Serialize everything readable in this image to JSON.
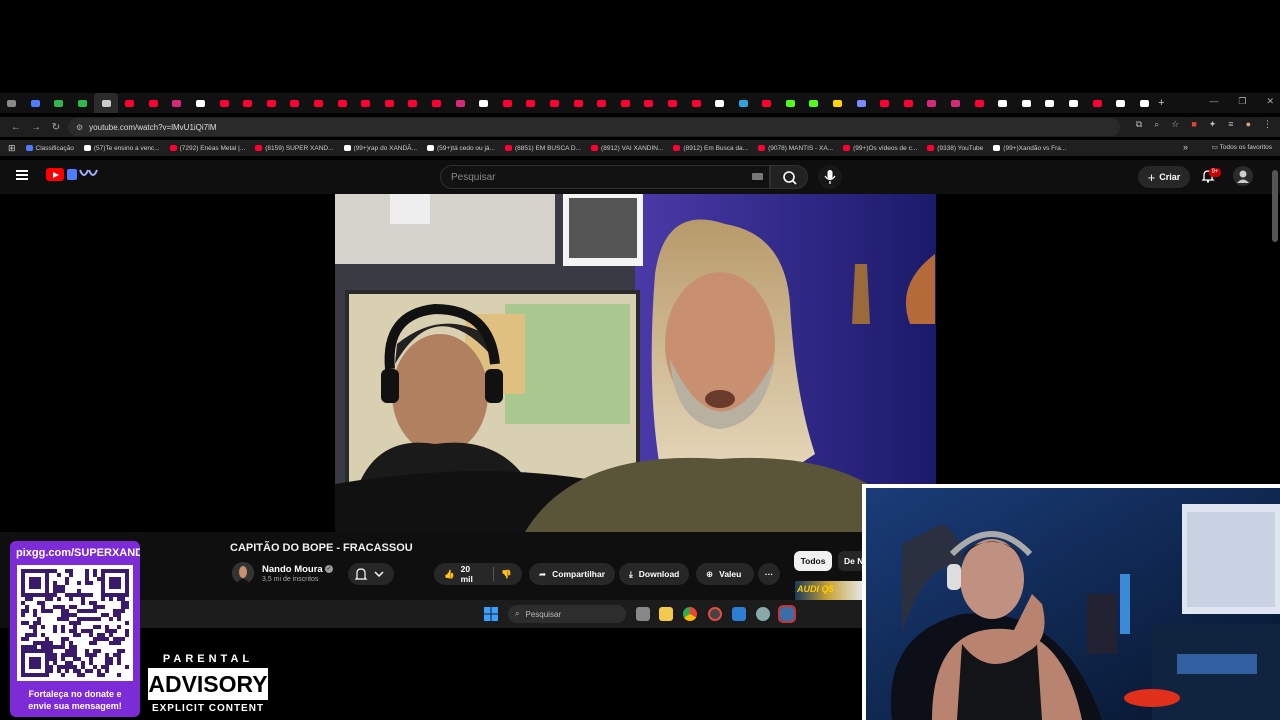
{
  "browser": {
    "url": "youtube.com/watch?v=lMvU1iQi7lM",
    "tab_colors": [
      "#888888",
      "#4f7cff",
      "#2fb84d",
      "#2fb84d",
      "#cccccc",
      "#ff0033",
      "#ff0033",
      "#d62976",
      "#ffffff",
      "#ff0033",
      "#ff0033",
      "#ff0033",
      "#ff0033",
      "#ff0033",
      "#ff0033",
      "#ff0033",
      "#ff0033",
      "#ff0033",
      "#ff0033",
      "#d62976",
      "#ffffff",
      "#ff0033",
      "#ff0033",
      "#ff0033",
      "#ff0033",
      "#ff0033",
      "#ff0033",
      "#ff0033",
      "#ff0033",
      "#ff0033",
      "#ffffff",
      "#2aa3e0",
      "#ff0033",
      "#53fc18",
      "#53fc18",
      "#ffd400",
      "#7a8cff",
      "#ff0033",
      "#ff0033",
      "#d62976",
      "#d62976",
      "#ff0033",
      "#ffffff",
      "#ffffff",
      "#ffffff",
      "#ffffff",
      "#ff0033",
      "#ffffff",
      "#ffffff"
    ],
    "bookmarks": [
      {
        "label": "Classificação",
        "color": "#4f7cff"
      },
      {
        "label": "(57)Te ensino a venc...",
        "color": "#ffffff"
      },
      {
        "label": "(7292) Enéas Metal |...",
        "color": "#ff0033"
      },
      {
        "label": "(8159) SUPER XAND...",
        "color": "#ff0033"
      },
      {
        "label": "(99+)rap do XANDÃ...",
        "color": "#ffffff"
      },
      {
        "label": "(59+)tá cedo ou já...",
        "color": "#ffffff"
      },
      {
        "label": "(8851) EM BUSCA D...",
        "color": "#ff0033"
      },
      {
        "label": "(8912) VAI XANDIN...",
        "color": "#ff0033"
      },
      {
        "label": "(8912) Em Busca da...",
        "color": "#ff0033"
      },
      {
        "label": "(9078) MANTIS - XA...",
        "color": "#ff0033"
      },
      {
        "label": "(99+)Os vídeos de c...",
        "color": "#ff0033"
      },
      {
        "label": "(9338) YouTube",
        "color": "#ff0033"
      },
      {
        "label": "(99+)Xandão vs Fra...",
        "color": "#ffffff"
      }
    ],
    "bookmarks_overflow": "»",
    "all_favorites": "Todos os favoritos"
  },
  "youtube": {
    "search_placeholder": "Pesquisar",
    "create_label": "Criar",
    "notif_badge": "9+",
    "video_title": "CAPITÃO DO BOPE - FRACASSOU",
    "channel_name": "Nando Moura",
    "verified_mark": "✓",
    "subscribers": "3,5 mi de inscritos",
    "likes": "20 mil",
    "share_label": "Compartilhar",
    "download_label": "Download",
    "thanks_label": "Valeu",
    "more_label": "···",
    "chip_all": "Todos",
    "chip_next": "De N",
    "thumb_text": "AUDI Q5"
  },
  "taskbar": {
    "search_placeholder": "Pesquisar"
  },
  "overlay": {
    "donate_url": "pixgg.com/SUPERXAND",
    "donate_message_line1": "Fortaleça no donate e",
    "donate_message_line2": "envie sua mensagem!",
    "pa_top": "PARENTAL",
    "pa_mid": "ADVISORY",
    "pa_bottom": "EXPLICIT CONTENT"
  }
}
